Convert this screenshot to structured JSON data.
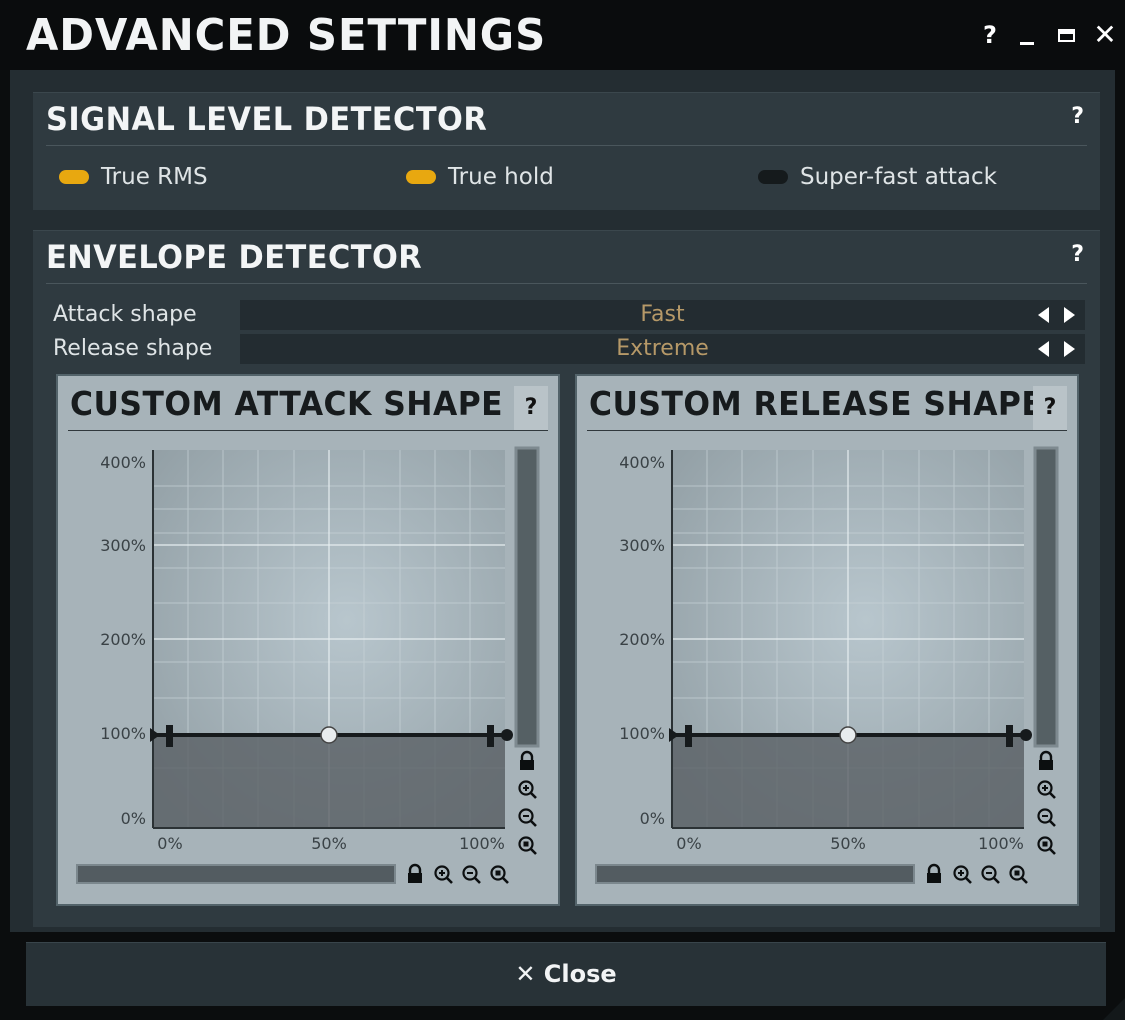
{
  "window": {
    "title": "ADVANCED SETTINGS",
    "help_label": "?",
    "close_glyph": "✕"
  },
  "signal_level_detector": {
    "title": "SIGNAL LEVEL DETECTOR",
    "help_label": "?",
    "toggles": [
      {
        "label": "True RMS",
        "on": true
      },
      {
        "label": "True hold",
        "on": true
      },
      {
        "label": "Super-fast attack",
        "on": false
      }
    ]
  },
  "envelope_detector": {
    "title": "ENVELOPE DETECTOR",
    "help_label": "?",
    "attack_shape": {
      "label": "Attack shape",
      "value": "Fast"
    },
    "release_shape": {
      "label": "Release shape",
      "value": "Extreme"
    }
  },
  "custom_attack_shape": {
    "title": "CUSTOM ATTACK SHAPE",
    "help_label": "?",
    "y_ticks": [
      "400%",
      "300%",
      "200%",
      "100%",
      "0%"
    ],
    "x_ticks": [
      "0%",
      "50%",
      "100%"
    ],
    "curve_level": "100%",
    "midpoint": "50%"
  },
  "custom_release_shape": {
    "title": "CUSTOM RELEASE SHAPE",
    "help_label": "?",
    "y_ticks": [
      "400%",
      "300%",
      "200%",
      "100%",
      "0%"
    ],
    "x_ticks": [
      "0%",
      "50%",
      "100%"
    ],
    "curve_level": "100%",
    "midpoint": "50%"
  },
  "icons": [
    "help-icon",
    "minimize-icon",
    "maximize-icon",
    "close-icon",
    "lock-icon",
    "zoom-in-icon",
    "zoom-out-icon",
    "zoom-reset-icon",
    "arrow-left-icon",
    "arrow-right-icon"
  ],
  "colors": {
    "toggle_on": "#e8a810",
    "toggle_off": "#151a1c",
    "value_text": "#b69968",
    "panel_bg": "#a7b3b9"
  },
  "footer": {
    "close_label": "✕ Close"
  }
}
